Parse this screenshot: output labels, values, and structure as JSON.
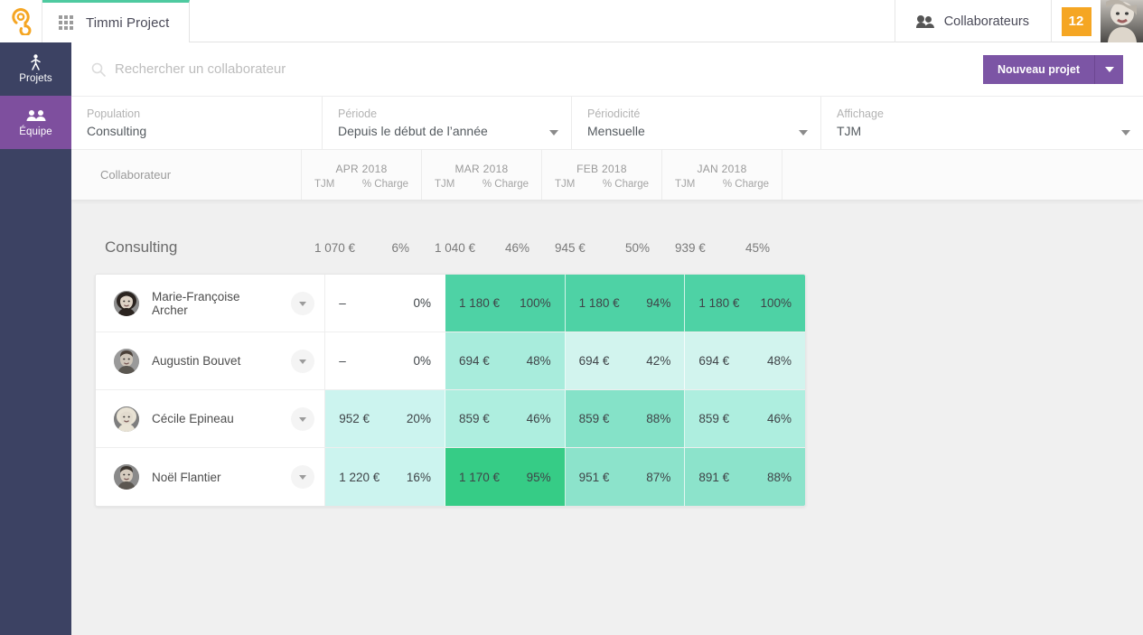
{
  "topbar": {
    "logo_name": "octopus-logo",
    "grid_icon": "apps-grid-icon",
    "app_tab_label": "Timmi Project",
    "collaborateurs_label": "Collaborateurs",
    "people_icon": "people-icon",
    "count_badge": "12",
    "avatar_name": "user-avatar"
  },
  "sidebar": {
    "items": [
      {
        "label": "Projets",
        "icon": "person-walking-icon",
        "active": false
      },
      {
        "label": "Équipe",
        "icon": "team-icon",
        "active": true
      }
    ]
  },
  "search": {
    "placeholder": "Rechercher un collaborateur",
    "value": "",
    "icon": "search-icon"
  },
  "actions": {
    "new_project_label": "Nouveau projet",
    "caret_icon": "chevron-down-icon"
  },
  "filters": [
    {
      "label": "Population",
      "value": "Consulting",
      "has_caret": false
    },
    {
      "label": "Période",
      "value": "Depuis le début de l’année",
      "has_caret": true
    },
    {
      "label": "Périodicité",
      "value": "Mensuelle",
      "has_caret": true
    },
    {
      "label": "Affichage",
      "value": "TJM",
      "has_caret": true
    }
  ],
  "table": {
    "collaborator_header": "Collaborateur",
    "columns": [
      {
        "month": "APR 2018",
        "sub_tjm": "TJM",
        "sub_charge": "% Charge"
      },
      {
        "month": "MAR 2018",
        "sub_tjm": "TJM",
        "sub_charge": "% Charge"
      },
      {
        "month": "FEB 2018",
        "sub_tjm": "TJM",
        "sub_charge": "% Charge"
      },
      {
        "month": "JAN 2018",
        "sub_tjm": "TJM",
        "sub_charge": "% Charge"
      }
    ],
    "summary": {
      "name": "Consulting",
      "cells": [
        {
          "tjm": "1 070 €",
          "charge": "6%"
        },
        {
          "tjm": "1 040 €",
          "charge": "46%"
        },
        {
          "tjm": "945 €",
          "charge": "50%"
        },
        {
          "tjm": "939 €",
          "charge": "45%"
        }
      ]
    },
    "rows": [
      {
        "name": "Marie-Françoise Archer",
        "chevron": "chevron-down-icon",
        "cells": [
          {
            "tjm": "–",
            "charge": "0%",
            "color": "#ffffff"
          },
          {
            "tjm": "1 180 €",
            "charge": "100%",
            "color": "#4ed2a5"
          },
          {
            "tjm": "1 180 €",
            "charge": "94%",
            "color": "#4ed2a5"
          },
          {
            "tjm": "1 180 €",
            "charge": "100%",
            "color": "#4ed2a5"
          }
        ]
      },
      {
        "name": "Augustin Bouvet",
        "chevron": "chevron-down-icon",
        "cells": [
          {
            "tjm": "–",
            "charge": "0%",
            "color": "#ffffff"
          },
          {
            "tjm": "694 €",
            "charge": "48%",
            "color": "#a8ecdc"
          },
          {
            "tjm": "694 €",
            "charge": "42%",
            "color": "#d2f4ee"
          },
          {
            "tjm": "694 €",
            "charge": "48%",
            "color": "#d2f4ee"
          }
        ]
      },
      {
        "name": "Cécile Epineau",
        "chevron": "chevron-down-icon",
        "cells": [
          {
            "tjm": "952 €",
            "charge": "20%",
            "color": "#ccf4ef"
          },
          {
            "tjm": "859 €",
            "charge": "46%",
            "color": "#aeeedf"
          },
          {
            "tjm": "859 €",
            "charge": "88%",
            "color": "#85e2c8"
          },
          {
            "tjm": "859 €",
            "charge": "46%",
            "color": "#aeeedf"
          }
        ]
      },
      {
        "name": "Noël Flantier",
        "chevron": "chevron-down-icon",
        "cells": [
          {
            "tjm": "1 220 €",
            "charge": "16%",
            "color": "#ccf4ef"
          },
          {
            "tjm": "1 170 €",
            "charge": "95%",
            "color": "#36cc86"
          },
          {
            "tjm": "951 €",
            "charge": "87%",
            "color": "#8ce3cb"
          },
          {
            "tjm": "891 €",
            "charge": "88%",
            "color": "#8ce3cb"
          }
        ]
      }
    ]
  },
  "colors": {
    "accent_purple": "#7c55a5",
    "sidebar_navy": "#3c4263",
    "sidebar_active": "#7e4f9e",
    "brand_orange": "#f5a623",
    "tab_green": "#4ecaa0",
    "badge_orange": "#f5a623"
  }
}
